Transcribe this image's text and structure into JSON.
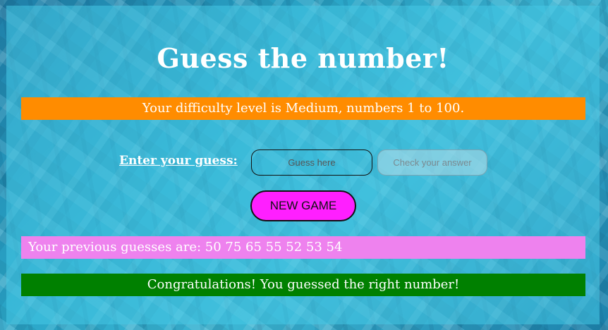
{
  "page": {
    "title": "Guess the number!"
  },
  "difficulty": {
    "text": "Your difficulty level is Medium, numbers 1 to 100.",
    "color": "#ff8c00"
  },
  "guess": {
    "label": "Enter your guess:",
    "placeholder": "Guess here",
    "value": "",
    "check_label": "Check your answer"
  },
  "controls": {
    "new_game_label": "NEW GAME",
    "new_game_color": "#ff1fff"
  },
  "previous": {
    "text": "Your previous guesses are: 50 75 65 55 52 53 54",
    "color": "#ee82ee"
  },
  "result": {
    "text": "Congratulations! You guessed the right number!",
    "color": "#008000"
  }
}
